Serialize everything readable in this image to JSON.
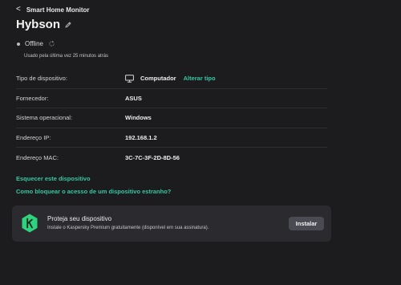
{
  "header": {
    "back_glyph": "<",
    "app_title": "Smart Home Monitor"
  },
  "device": {
    "name": "Hybson",
    "status": "Offline",
    "last_seen": "Usado pela última vez 25 minutos atrás"
  },
  "details": [
    {
      "label": "Tipo de dispositivo:",
      "value": "Computador",
      "icon": "monitor-icon",
      "action": "Alterar tipo"
    },
    {
      "label": "Fornecedor:",
      "value": "ASUS"
    },
    {
      "label": "Sistema operacional:",
      "value": "Windows"
    },
    {
      "label": "Endereço IP:",
      "value": "192.168.1.2"
    },
    {
      "label": "Endereço MAC:",
      "value": "3C-7C-3F-2D-8D-56"
    }
  ],
  "links": {
    "forget": "Esquecer este dispositivo",
    "block_help": "Como bloquear o acesso de um dispositivo estranho?"
  },
  "promo": {
    "title": "Proteja seu dispositivo",
    "text": "Instale o Kaspersky Premium gratuitamente (disponível em sua assinatura).",
    "button": "Instalar",
    "logo_icon": "kaspersky-logo-icon"
  },
  "colors": {
    "background": "#1c1c1f",
    "accent": "#35c7a0",
    "card": "#2a2a2f",
    "button": "#4a4a52"
  }
}
